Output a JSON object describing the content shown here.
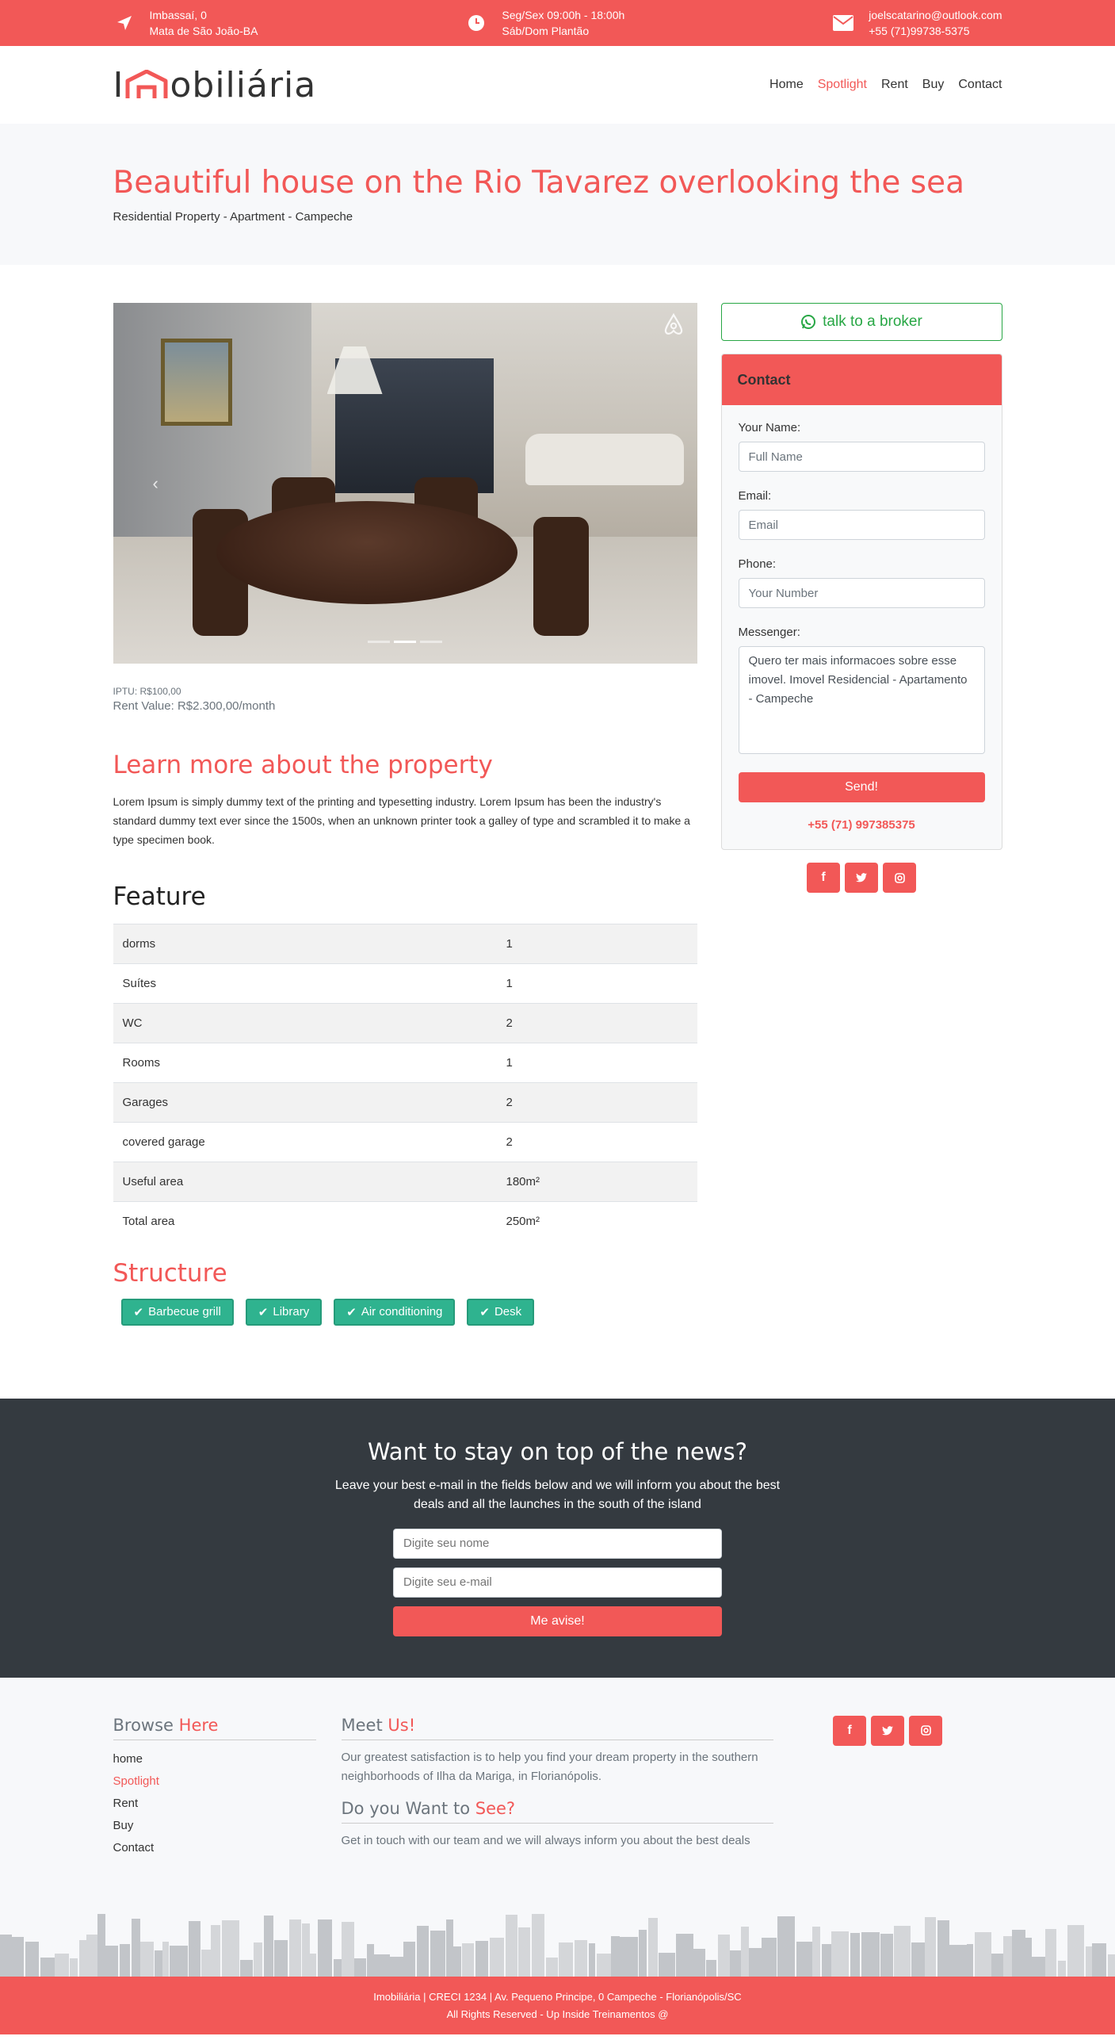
{
  "topbar": {
    "address_line1": "Imbassaí, 0",
    "address_line2": "Mata de São João-BA",
    "hours_line1": "Seg/Sex 09:00h - 18:00h",
    "hours_line2": "Sáb/Dom Plantão",
    "email": "joelscatarino@outlook.com",
    "phone": "+55 (71)99738-5375"
  },
  "header": {
    "logo_text_left": "I",
    "logo_text_right": "obiliária",
    "nav": [
      {
        "label": "Home",
        "active": false
      },
      {
        "label": "Spotlight",
        "active": true
      },
      {
        "label": "Rent",
        "active": false
      },
      {
        "label": "Buy",
        "active": false
      },
      {
        "label": "Contact",
        "active": false
      }
    ]
  },
  "title": {
    "heading": "Beautiful house on the Rio Tavarez overlooking the sea",
    "subheading": "Residential Property - Apartment - Campeche"
  },
  "property": {
    "iptu": "IPTU: R$100,00",
    "rent_value": "Rent Value: R$2.300,00/month",
    "learn_heading": "Learn more about the property",
    "learn_text": "Lorem Ipsum is simply dummy text of the printing and typesetting industry. Lorem Ipsum has been the industry's standard dummy text ever since the 1500s, when an unknown printer took a galley of type and scrambled it to make a type specimen book.",
    "feature_heading": "Feature",
    "features": [
      {
        "name": "dorms",
        "value": "1"
      },
      {
        "name": "Suítes",
        "value": "1"
      },
      {
        "name": "WC",
        "value": "2"
      },
      {
        "name": "Rooms",
        "value": "1"
      },
      {
        "name": "Garages",
        "value": "2"
      },
      {
        "name": "covered garage",
        "value": "2"
      },
      {
        "name": "Useful area",
        "value": "180m²"
      },
      {
        "name": "Total area",
        "value": "250m²"
      }
    ],
    "structure_heading": "Structure",
    "structure": [
      "Barbecue grill",
      "Library",
      "Air conditioning",
      "Desk"
    ]
  },
  "sidebar": {
    "broker_button": "talk to a broker",
    "contact_title": "Contact",
    "name_label": "Your Name:",
    "name_placeholder": "Full Name",
    "email_label": "Email:",
    "email_placeholder": "Email",
    "phone_label": "Phone:",
    "phone_placeholder": "Your Number",
    "message_label": "Messenger:",
    "message_value": "Quero ter mais informacoes sobre esse imovel. Imovel Residencial - Apartamento - Campeche",
    "send_button": "Send!",
    "phone_number": "+55 (71) 997385375"
  },
  "news": {
    "heading": "Want to stay on top of the news?",
    "text": "Leave your best e-mail in the fields below and we will inform you about the best deals and all the launches in the south of the island",
    "name_placeholder": "Digite seu nome",
    "email_placeholder": "Digite seu e-mail",
    "button": "Me avise!"
  },
  "footer": {
    "browse_heading_a": "Browse",
    "browse_heading_b": "Here",
    "links": [
      {
        "label": "home",
        "active": false
      },
      {
        "label": "Spotlight",
        "active": true
      },
      {
        "label": "Rent",
        "active": false
      },
      {
        "label": "Buy",
        "active": false
      },
      {
        "label": "Contact",
        "active": false
      }
    ],
    "meet_heading_a": "Meet",
    "meet_heading_b": "Us!",
    "meet_text": "Our greatest satisfaction is to help you find your dream property in the southern neighborhoods of Ilha da Mariga, in Florianópolis.",
    "see_heading_a": "Do you Want to",
    "see_heading_b": "See?",
    "see_text": "Get in touch with our team and we will always inform you about the best deals",
    "bottom_line1": "Imobiliária | CRECI 1234 | Av. Pequeno Principe, 0 Campeche - Florianópolis/SC",
    "bottom_line2": "All Rights Reserved - Up Inside Treinamentos @"
  },
  "colors": {
    "accent": "#f25857",
    "success": "#2fb38f",
    "dark": "#343a40"
  },
  "icons": [
    "location-arrow-icon",
    "clock-icon",
    "envelope-icon",
    "airbnb-icon",
    "whatsapp-icon",
    "check-icon",
    "facebook-icon",
    "twitter-icon",
    "instagram-icon"
  ]
}
